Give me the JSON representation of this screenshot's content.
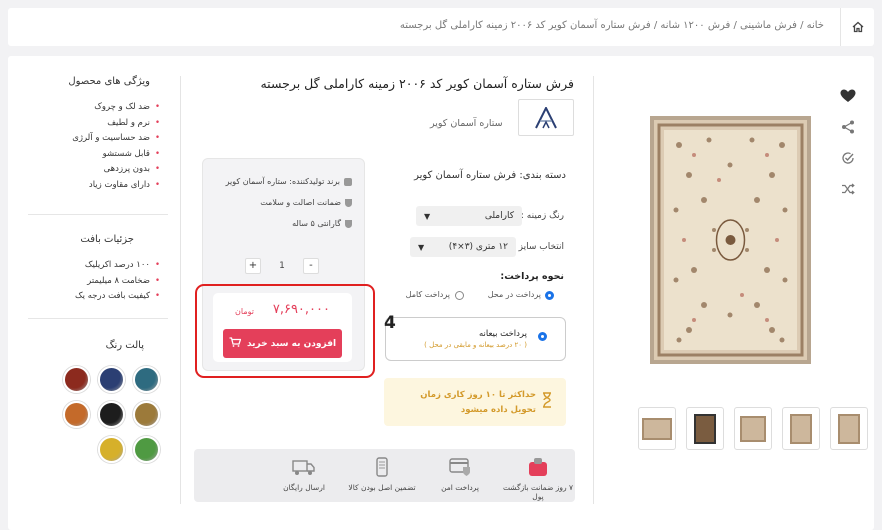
{
  "breadcrumb": {
    "text": "خانه / فرش ماشینی / فرش ۱۲۰۰ شانه / فرش ستاره آسمان کویر کد ۲۰۰۶ زمینه کاراملی گل برجسته"
  },
  "gallery": {
    "icons": [
      "heart-icon",
      "share-icon",
      "compare-icon",
      "shuffle-icon"
    ],
    "thumbnail_count": 5
  },
  "product": {
    "title": "فرش ستاره آسمان کویر کد ۲۰۰۶ زمینه کاراملی گل برجسته",
    "brand_name": "ستاره آسمان کویر",
    "category_label": "دسته بندی: فرش ستاره آسمان کویر"
  },
  "options": {
    "color_label": "رنگ زمینه :",
    "color_value": "کاراملی",
    "size_label": "انتخاب سایز :",
    "size_value": "۱۲ متری (۳×۴)"
  },
  "payment": {
    "title": "نحوه پرداخت:",
    "cod": "پرداخت در محل",
    "full": "پرداخت کامل",
    "installment": "پرداخت بیعانه",
    "installment_note": "( ۲۰ درصد بیعانه و مابقی در محل )"
  },
  "delivery": {
    "text": "حداکثر تا ۱۰ روز کاری زمان تحویل داده میشود"
  },
  "buybox": {
    "producer": "برند تولیدکننده: ستاره آسمان کویر",
    "authenticity": "ضمانت اصالت و سلامت",
    "warranty": "گارانتی ۵ ساله",
    "qty_value": "1",
    "plus": "+",
    "minus": "-",
    "price": "۷,۶۹۰,۰۰۰",
    "currency": "تومان",
    "add_to_cart": "افزودن به سبد خرید"
  },
  "annotation": {
    "number": "4"
  },
  "trust": {
    "items": [
      "۷ روز ضمانت بازگشت پول",
      "پرداخت امن",
      "تضمین اصل بودن کالا",
      "ارسال رایگان"
    ]
  },
  "sidebar": {
    "features_title": "ویژگی های محصول",
    "features": [
      "ضد لک و چروک",
      "نرم و لطیف",
      "ضد حساسیت و آلرژی",
      "قابل شستشو",
      "بدون پرزدهی",
      "دارای مقاوت زیاد"
    ],
    "weave_title": "جزئیات بافت",
    "weave": [
      "۱۰۰ درصد اکریلیک",
      "ضخامت ۸ میلیمتر",
      "کیفیت بافت درجه یک"
    ],
    "palette_title": "پالت رنگ",
    "palette": [
      "#2e6b80",
      "#2b3f73",
      "#8c2a1e",
      "#9c7a3a",
      "#1d1d1d",
      "#c46a2a",
      "#4f9a42",
      "#d6b02a"
    ]
  }
}
